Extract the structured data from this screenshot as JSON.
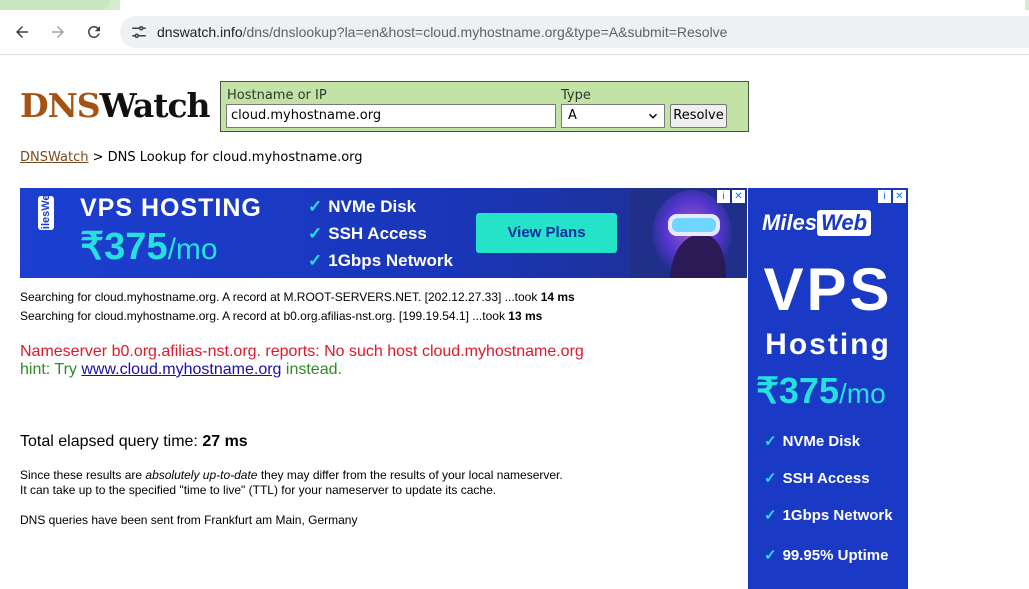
{
  "browser": {
    "url_host": "dnswatch.info",
    "url_path": "/dns/dnslookup?la=en&host=cloud.myhostname.org&type=A&submit=Resolve"
  },
  "logo": {
    "part1": "DNS",
    "part2": "Watch"
  },
  "form": {
    "hostname_label": "Hostname or IP",
    "hostname_value": "cloud.myhostname.org",
    "type_label": "Type",
    "type_value": "A",
    "resolve_label": "Resolve"
  },
  "breadcrumb": {
    "home_link": "DNSWatch",
    "separator": ">",
    "current": "DNS Lookup for cloud.myhostname.org"
  },
  "banner_ad": {
    "brand": "MilesWeb",
    "headline": "VPS HOSTING",
    "price": "₹375",
    "per": "/mo",
    "features": [
      "NVMe Disk",
      "SSH Access",
      "1Gbps Network"
    ],
    "cta": "View Plans"
  },
  "side_ad": {
    "brand_miles": "Miles",
    "brand_web": "Web",
    "vps": "VPS",
    "hosting": "Hosting",
    "price": "₹375",
    "per": "/mo",
    "features": [
      "NVMe Disk",
      "SSH Access",
      "1Gbps Network",
      "99.95% Uptime"
    ]
  },
  "results": {
    "search_lines": [
      {
        "text": "Searching for cloud.myhostname.org. A record at M.ROOT-SERVERS.NET. [202.12.27.33] ...took ",
        "took": "14 ms"
      },
      {
        "text": "Searching for cloud.myhostname.org. A record at b0.org.afilias-nst.org. [199.19.54.1] ...took ",
        "took": "13 ms"
      }
    ],
    "error": "Nameserver b0.org.afilias-nst.org. reports: No such host cloud.myhostname.org",
    "hint_prefix": "hint: Try ",
    "hint_link": "www.cloud.myhostname.org",
    "hint_suffix": " instead.",
    "elapsed_label": "Total elapsed query time: ",
    "elapsed_value": "27 ms",
    "note1_a": "Since these results are ",
    "note1_em": "absolutely up-to-date",
    "note1_b": " they may differ from the results of your local nameserver.",
    "note2": "It can take up to the specified \"time to live\" (TTL) for your nameserver to update its cache.",
    "note3": "DNS queries have been sent from Frankfurt am Main, Germany"
  },
  "colors": {
    "logo_dns": "#a55215",
    "form_bg": "#c2e2a6",
    "error": "#e0182d",
    "hint": "#2e8b22",
    "ad_blue": "#1a39c4",
    "ad_cyan": "#26e0e0"
  }
}
